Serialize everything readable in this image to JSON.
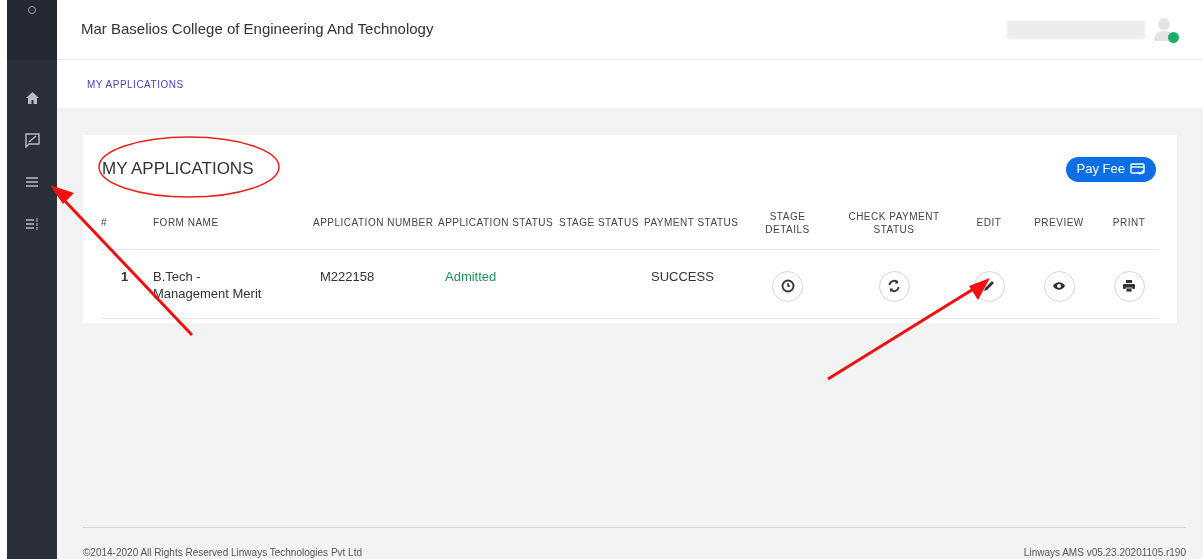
{
  "header": {
    "title": "Mar Baselios College of Engineering And Technology",
    "user_online": true
  },
  "breadcrumb": "MY APPLICATIONS",
  "panel": {
    "title": "MY APPLICATIONS",
    "pay_button": "Pay Fee",
    "table": {
      "columns": [
        "#",
        "FORM NAME",
        "APPLICATION NUMBER",
        "APPLICATION STATUS",
        "STAGE STATUS",
        "PAYMENT STATUS",
        "STAGE DETAILS",
        "CHECK PAYMENT STATUS",
        "EDIT",
        "PREVIEW",
        "PRINT"
      ],
      "rows": [
        {
          "index": "1",
          "form_name": "B.Tech - Management Merit",
          "application_number": "M222158",
          "application_status": "Admitted",
          "payment_status": "SUCCESS"
        }
      ]
    }
  },
  "footer": {
    "copyright": "©2014-2020 All Rights Reserved Linways Technologies Pvt Ltd",
    "version": "Linways AMS v05.23.20201105.r190"
  }
}
